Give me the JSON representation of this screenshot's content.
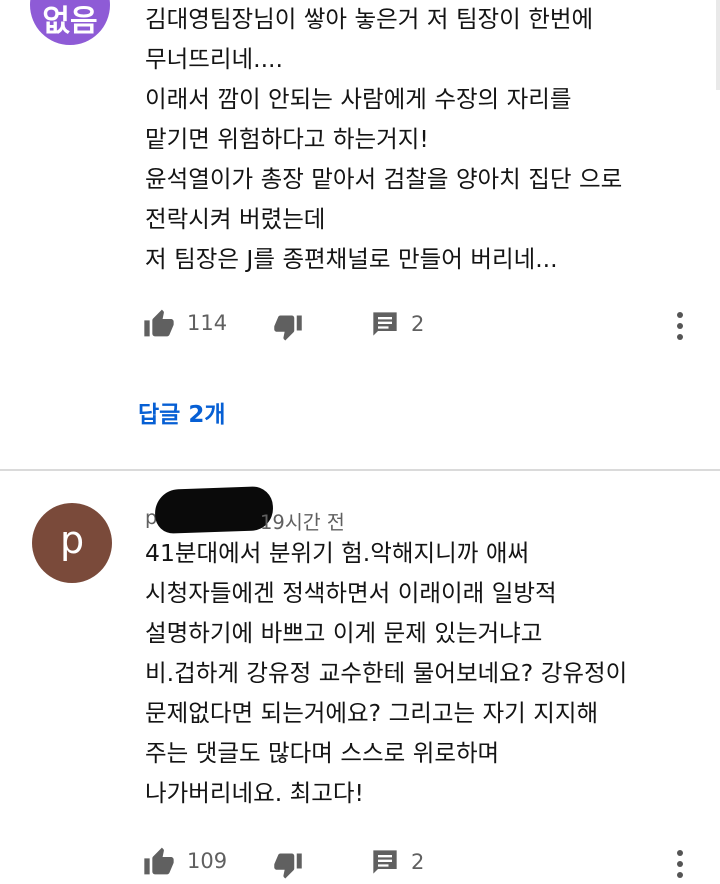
{
  "comments": [
    {
      "avatar_text": "없음",
      "avatar_color": "#8e5bd6",
      "lines": [
        "김대영팀장님이 쌓아 놓은거 저 팀장이 한번에",
        "무너뜨리네....",
        "이래서 깜이 안되는 사람에게 수장의 자리를",
        "맡기면 위험하다고 하는거지!",
        "윤석열이가 총장 맡아서 검찰을 양아치 집단 으로",
        "전락시켜 버렸는데",
        "저 팀장은 J를 종편채널로 만들어 버리네..."
      ],
      "like_count": "114",
      "reply_count": "2",
      "replies_link": "답글 2개"
    },
    {
      "avatar_text": "p",
      "avatar_color": "#7a4a3a",
      "author": "p",
      "timestamp": "19시간 전",
      "lines": [
        "41분대에서 분위기 험.악해지니까 애써",
        "시청자들에겐 정색하면서 이래이래 일방적",
        "설명하기에 바쁘고 이게 문제 있는거냐고",
        "비.겁하게 강유정 교수한테 물어보네요? 강유정이",
        "문제없다면 되는거에요? 그리고는 자기 지지해",
        "주는 댓글도 많다며 스스로 위로하며",
        "나가버리네요. 최고다!"
      ],
      "like_count": "109",
      "reply_count": "2"
    }
  ],
  "icons": {
    "like": "thumbs-up-icon",
    "dislike": "thumbs-down-icon",
    "reply": "comment-icon",
    "more": "more-vert-icon"
  },
  "colors": {
    "link": "#065fd4",
    "icon": "#606060",
    "divider": "#dadada"
  }
}
